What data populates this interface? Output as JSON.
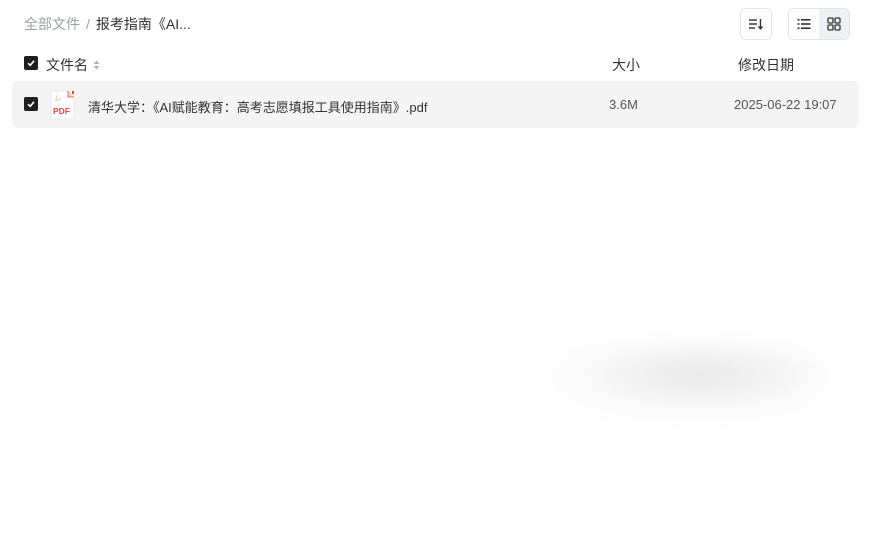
{
  "breadcrumb": {
    "root": "全部文件",
    "separator": "/",
    "current": "报考指南《AI..."
  },
  "toolbar": {
    "sort_icon": "sort-icon",
    "list_view_icon": "list-view-icon",
    "grid_view_icon": "grid-view-icon"
  },
  "header": {
    "name": "文件名",
    "size": "大小",
    "modified": "修改日期"
  },
  "files": [
    {
      "name": "清华大学：《AI赋能教育：高考志愿填报工具使用指南》.pdf",
      "size": "3.6M",
      "modified": "2025-06-22 19:07",
      "icon": "pdf-icon",
      "icon_label": "PDF",
      "selected": true
    }
  ],
  "colors": {
    "pdf_red": "#e8463f",
    "row_bg": "#f4f4f5",
    "checkbox": "#1f1f1f"
  }
}
